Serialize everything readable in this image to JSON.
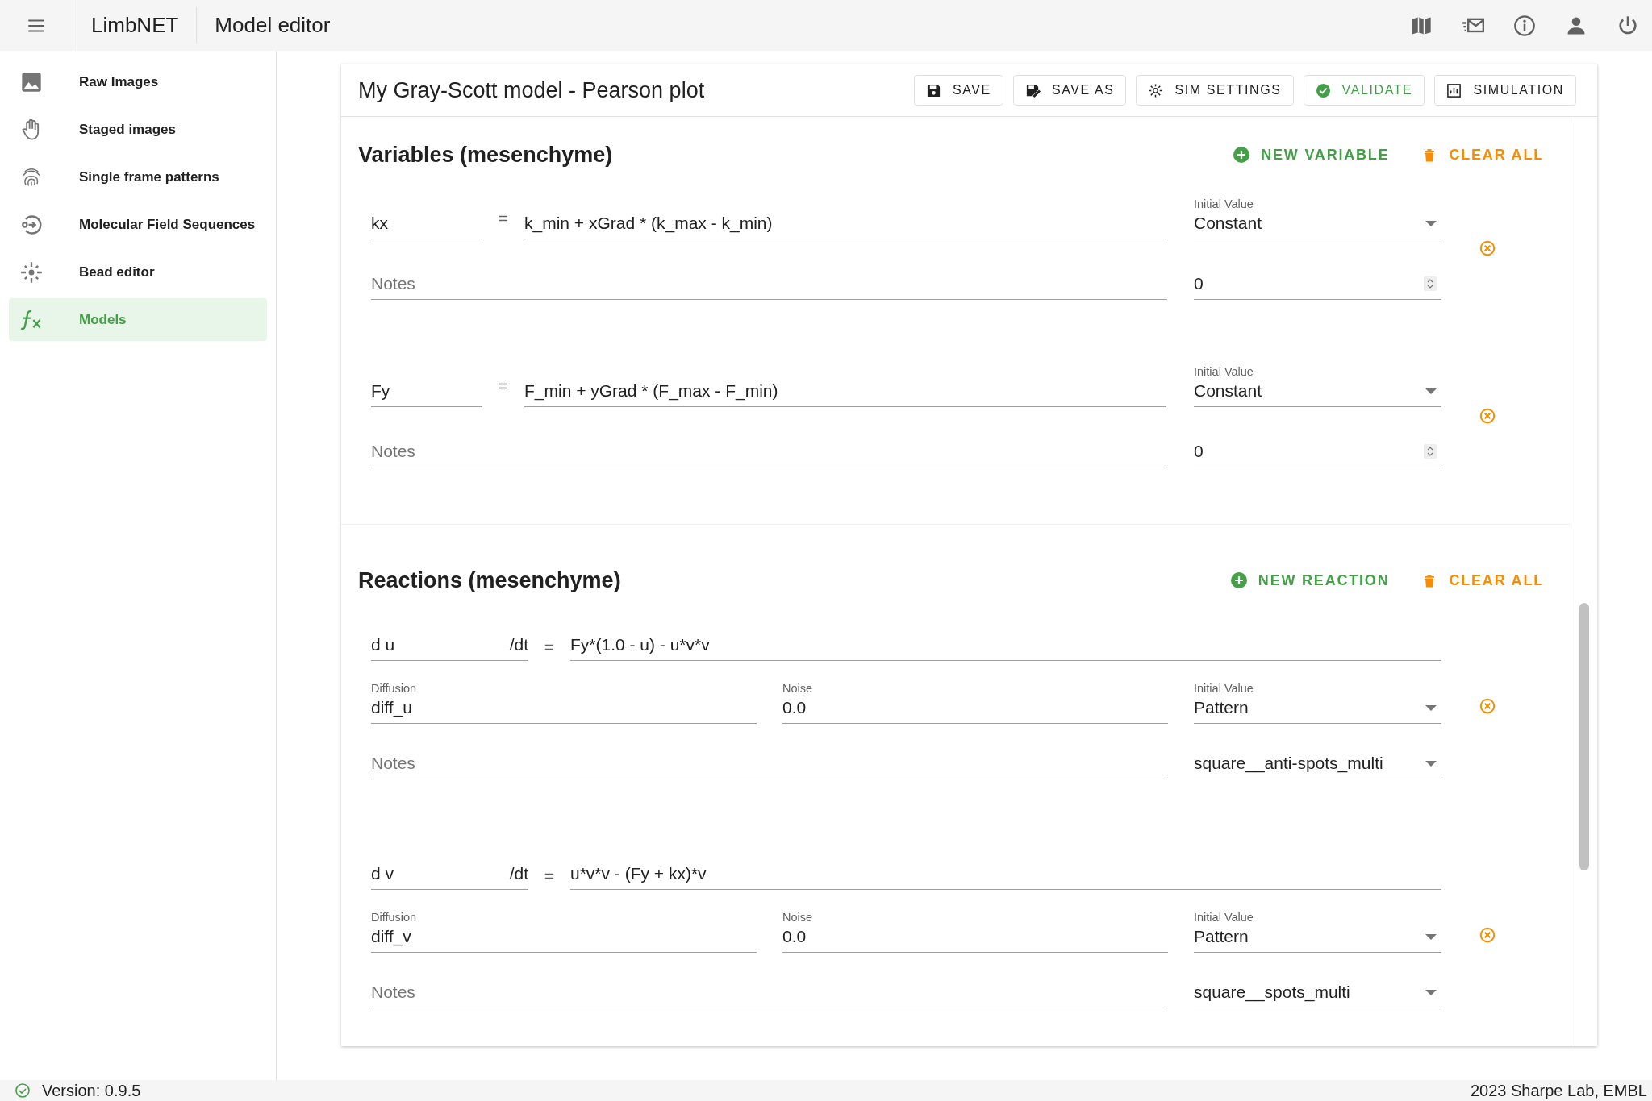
{
  "app": {
    "name": "LimbNET",
    "page_title": "Model editor"
  },
  "sidebar": {
    "items": [
      {
        "label": "Raw Images",
        "selected": false
      },
      {
        "label": "Staged images",
        "selected": false
      },
      {
        "label": "Single frame patterns",
        "selected": false
      },
      {
        "label": "Molecular Field Sequences",
        "selected": false
      },
      {
        "label": "Bead editor",
        "selected": false
      },
      {
        "label": "Models",
        "selected": true
      }
    ]
  },
  "editor": {
    "title": "My Gray-Scott model - Pearson plot",
    "toolbar": [
      {
        "label": "SAVE",
        "kind": "normal"
      },
      {
        "label": "SAVE AS",
        "kind": "normal"
      },
      {
        "label": "SIM SETTINGS",
        "kind": "normal"
      },
      {
        "label": "VALIDATE",
        "kind": "success"
      },
      {
        "label": "SIMULATION",
        "kind": "normal"
      }
    ]
  },
  "variables_section": {
    "title": "Variables (mesenchyme)",
    "actions": [
      {
        "label": "NEW VARIABLE",
        "kind": "add"
      },
      {
        "label": "CLEAR ALL",
        "kind": "clear"
      }
    ],
    "variables": [
      {
        "name": "kx",
        "operator": "=",
        "expression": "k_min + xGrad * (k_max - k_min)",
        "initial_value_label": "Initial Value",
        "initial_value": "Constant",
        "notes_placeholder": "Notes",
        "value": "0"
      },
      {
        "name": "Fy",
        "operator": "=",
        "expression": "F_min + yGrad * (F_max - F_min)",
        "initial_value_label": "Initial Value",
        "initial_value": "Constant",
        "notes_placeholder": "Notes",
        "value": "0"
      }
    ]
  },
  "reactions_section": {
    "title": "Reactions (mesenchyme)",
    "actions": [
      {
        "label": "NEW REACTION",
        "kind": "add"
      },
      {
        "label": "CLEAR ALL",
        "kind": "clear"
      }
    ],
    "reactions": [
      {
        "species": "d u",
        "suffix": "/dt",
        "operator": "=",
        "expression": "Fy*(1.0 - u) - u*v*v",
        "diffusion_label": "Diffusion",
        "diffusion": "diff_u",
        "noise_label": "Noise",
        "noise": "0.0",
        "initial_value_label": "Initial Value",
        "initial_value": "Pattern",
        "notes_placeholder": "Notes",
        "pattern": "square__anti-spots_multi"
      },
      {
        "species": "d v",
        "suffix": "/dt",
        "operator": "=",
        "expression": "u*v*v - (Fy + kx)*v",
        "diffusion_label": "Diffusion",
        "diffusion": "diff_v",
        "noise_label": "Noise",
        "noise": "0.0",
        "initial_value_label": "Initial Value",
        "initial_value": "Pattern",
        "notes_placeholder": "Notes",
        "pattern": "square__spots_multi"
      }
    ]
  },
  "status_bar": {
    "version": "Version: 0.9.5",
    "credit": "2023 Sharpe Lab, EMBL"
  }
}
